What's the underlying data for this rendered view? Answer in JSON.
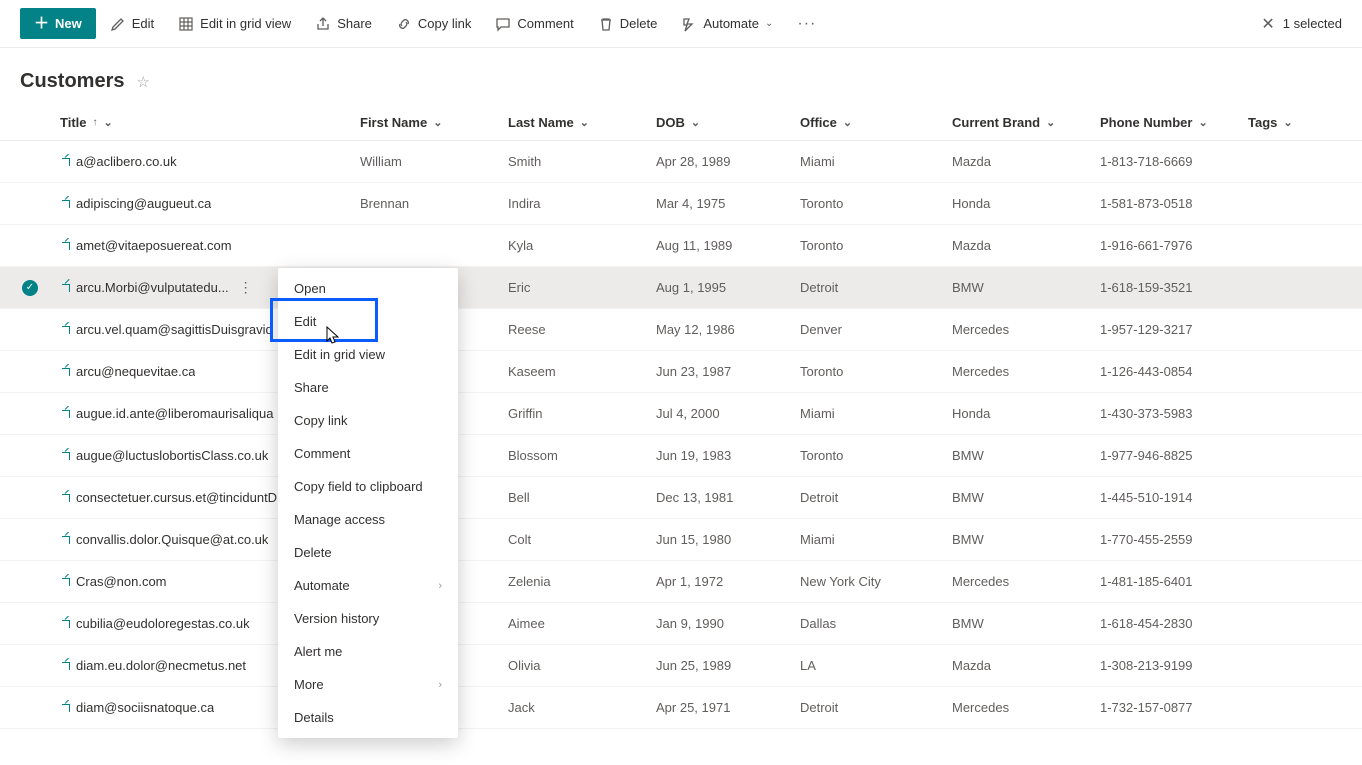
{
  "toolbar": {
    "new_label": "New",
    "edit_label": "Edit",
    "grid_label": "Edit in grid view",
    "share_label": "Share",
    "copylink_label": "Copy link",
    "comment_label": "Comment",
    "delete_label": "Delete",
    "automate_label": "Automate",
    "selected_label": "1 selected"
  },
  "page": {
    "title": "Customers"
  },
  "columns": {
    "title": "Title",
    "first_name": "First Name",
    "last_name": "Last Name",
    "dob": "DOB",
    "office": "Office",
    "brand": "Current Brand",
    "phone": "Phone Number",
    "tags": "Tags"
  },
  "rows": [
    {
      "title": "a@aclibero.co.uk",
      "first": "William",
      "last": "Smith",
      "dob": "Apr 28, 1989",
      "office": "Miami",
      "brand": "Mazda",
      "phone": "1-813-718-6669",
      "selected": false
    },
    {
      "title": "adipiscing@augueut.ca",
      "first": "Brennan",
      "last": "Indira",
      "dob": "Mar 4, 1975",
      "office": "Toronto",
      "brand": "Honda",
      "phone": "1-581-873-0518",
      "selected": false
    },
    {
      "title": "amet@vitaeposuereat.com",
      "first": "",
      "last": "Kyla",
      "dob": "Aug 11, 1989",
      "office": "Toronto",
      "brand": "Mazda",
      "phone": "1-916-661-7976",
      "selected": false
    },
    {
      "title": "arcu.Morbi@vulputatedu...",
      "first": "",
      "last": "Eric",
      "dob": "Aug 1, 1995",
      "office": "Detroit",
      "brand": "BMW",
      "phone": "1-618-159-3521",
      "selected": true
    },
    {
      "title": "arcu.vel.quam@sagittisDuisgravid",
      "first": "",
      "last": "Reese",
      "dob": "May 12, 1986",
      "office": "Denver",
      "brand": "Mercedes",
      "phone": "1-957-129-3217",
      "selected": false
    },
    {
      "title": "arcu@nequevitae.ca",
      "first": "",
      "last": "Kaseem",
      "dob": "Jun 23, 1987",
      "office": "Toronto",
      "brand": "Mercedes",
      "phone": "1-126-443-0854",
      "selected": false
    },
    {
      "title": "augue.id.ante@liberomaurisaliqua",
      "first": "",
      "last": "Griffin",
      "dob": "Jul 4, 2000",
      "office": "Miami",
      "brand": "Honda",
      "phone": "1-430-373-5983",
      "selected": false
    },
    {
      "title": "augue@luctuslobortisClass.co.uk",
      "first": "",
      "last": "Blossom",
      "dob": "Jun 19, 1983",
      "office": "Toronto",
      "brand": "BMW",
      "phone": "1-977-946-8825",
      "selected": false
    },
    {
      "title": "consectetuer.cursus.et@tinciduntD",
      "first": "",
      "last": "Bell",
      "dob": "Dec 13, 1981",
      "office": "Detroit",
      "brand": "BMW",
      "phone": "1-445-510-1914",
      "selected": false
    },
    {
      "title": "convallis.dolor.Quisque@at.co.uk",
      "first": "",
      "last": "Colt",
      "dob": "Jun 15, 1980",
      "office": "Miami",
      "brand": "BMW",
      "phone": "1-770-455-2559",
      "selected": false
    },
    {
      "title": "Cras@non.com",
      "first": "",
      "last": "Zelenia",
      "dob": "Apr 1, 1972",
      "office": "New York City",
      "brand": "Mercedes",
      "phone": "1-481-185-6401",
      "selected": false
    },
    {
      "title": "cubilia@eudoloregestas.co.uk",
      "first": "",
      "last": "Aimee",
      "dob": "Jan 9, 1990",
      "office": "Dallas",
      "brand": "BMW",
      "phone": "1-618-454-2830",
      "selected": false
    },
    {
      "title": "diam.eu.dolor@necmetus.net",
      "first": "",
      "last": "Olivia",
      "dob": "Jun 25, 1989",
      "office": "LA",
      "brand": "Mazda",
      "phone": "1-308-213-9199",
      "selected": false
    },
    {
      "title": "diam@sociisnatoque.ca",
      "first": "",
      "last": "Jack",
      "dob": "Apr 25, 1971",
      "office": "Detroit",
      "brand": "Mercedes",
      "phone": "1-732-157-0877",
      "selected": false
    }
  ],
  "context_menu": {
    "open": "Open",
    "edit": "Edit",
    "grid": "Edit in grid view",
    "share": "Share",
    "copylink": "Copy link",
    "comment": "Comment",
    "copyfield": "Copy field to clipboard",
    "access": "Manage access",
    "delete": "Delete",
    "automate": "Automate",
    "version": "Version history",
    "alert": "Alert me",
    "more": "More",
    "details": "Details"
  }
}
